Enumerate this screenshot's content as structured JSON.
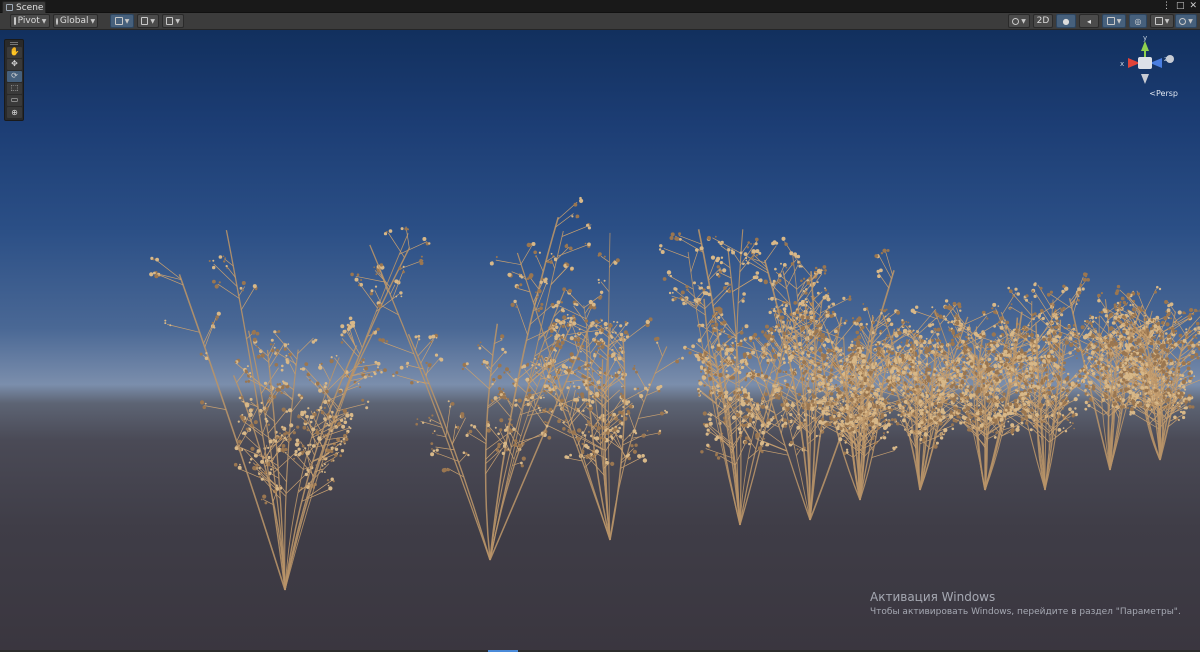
{
  "window": {
    "tab_label": "Scene",
    "menu_glyph": "⋮",
    "maximize_glyph": "□",
    "close_glyph": "✕"
  },
  "toolbar": {
    "pivot_label": "Pivot",
    "global_label": "Global",
    "mode_2d_label": "2D"
  },
  "tools": [
    {
      "name": "hand",
      "glyph": "✋",
      "active": false
    },
    {
      "name": "move",
      "glyph": "✥",
      "active": false
    },
    {
      "name": "rotate",
      "glyph": "⟳",
      "active": true
    },
    {
      "name": "scale",
      "glyph": "⬚",
      "active": false
    },
    {
      "name": "rect",
      "glyph": "▭",
      "active": false
    },
    {
      "name": "transform",
      "glyph": "⊕",
      "active": false
    }
  ],
  "gizmo": {
    "axis_y": "y",
    "axis_x": "x",
    "axis_z": "z",
    "projection_label": "Persp",
    "colors": {
      "x": "#e0443a",
      "y": "#8fd14f",
      "z": "#4a7ee0"
    }
  },
  "watermark": {
    "title": "Активация Windows",
    "subtitle": "Чтобы активировать Windows, перейдите в раздел \"Параметры\"."
  },
  "colors": {
    "accent": "#46607c",
    "sky_top": "#12305e",
    "ground": "#3a363f",
    "plant": "#c8a070"
  }
}
